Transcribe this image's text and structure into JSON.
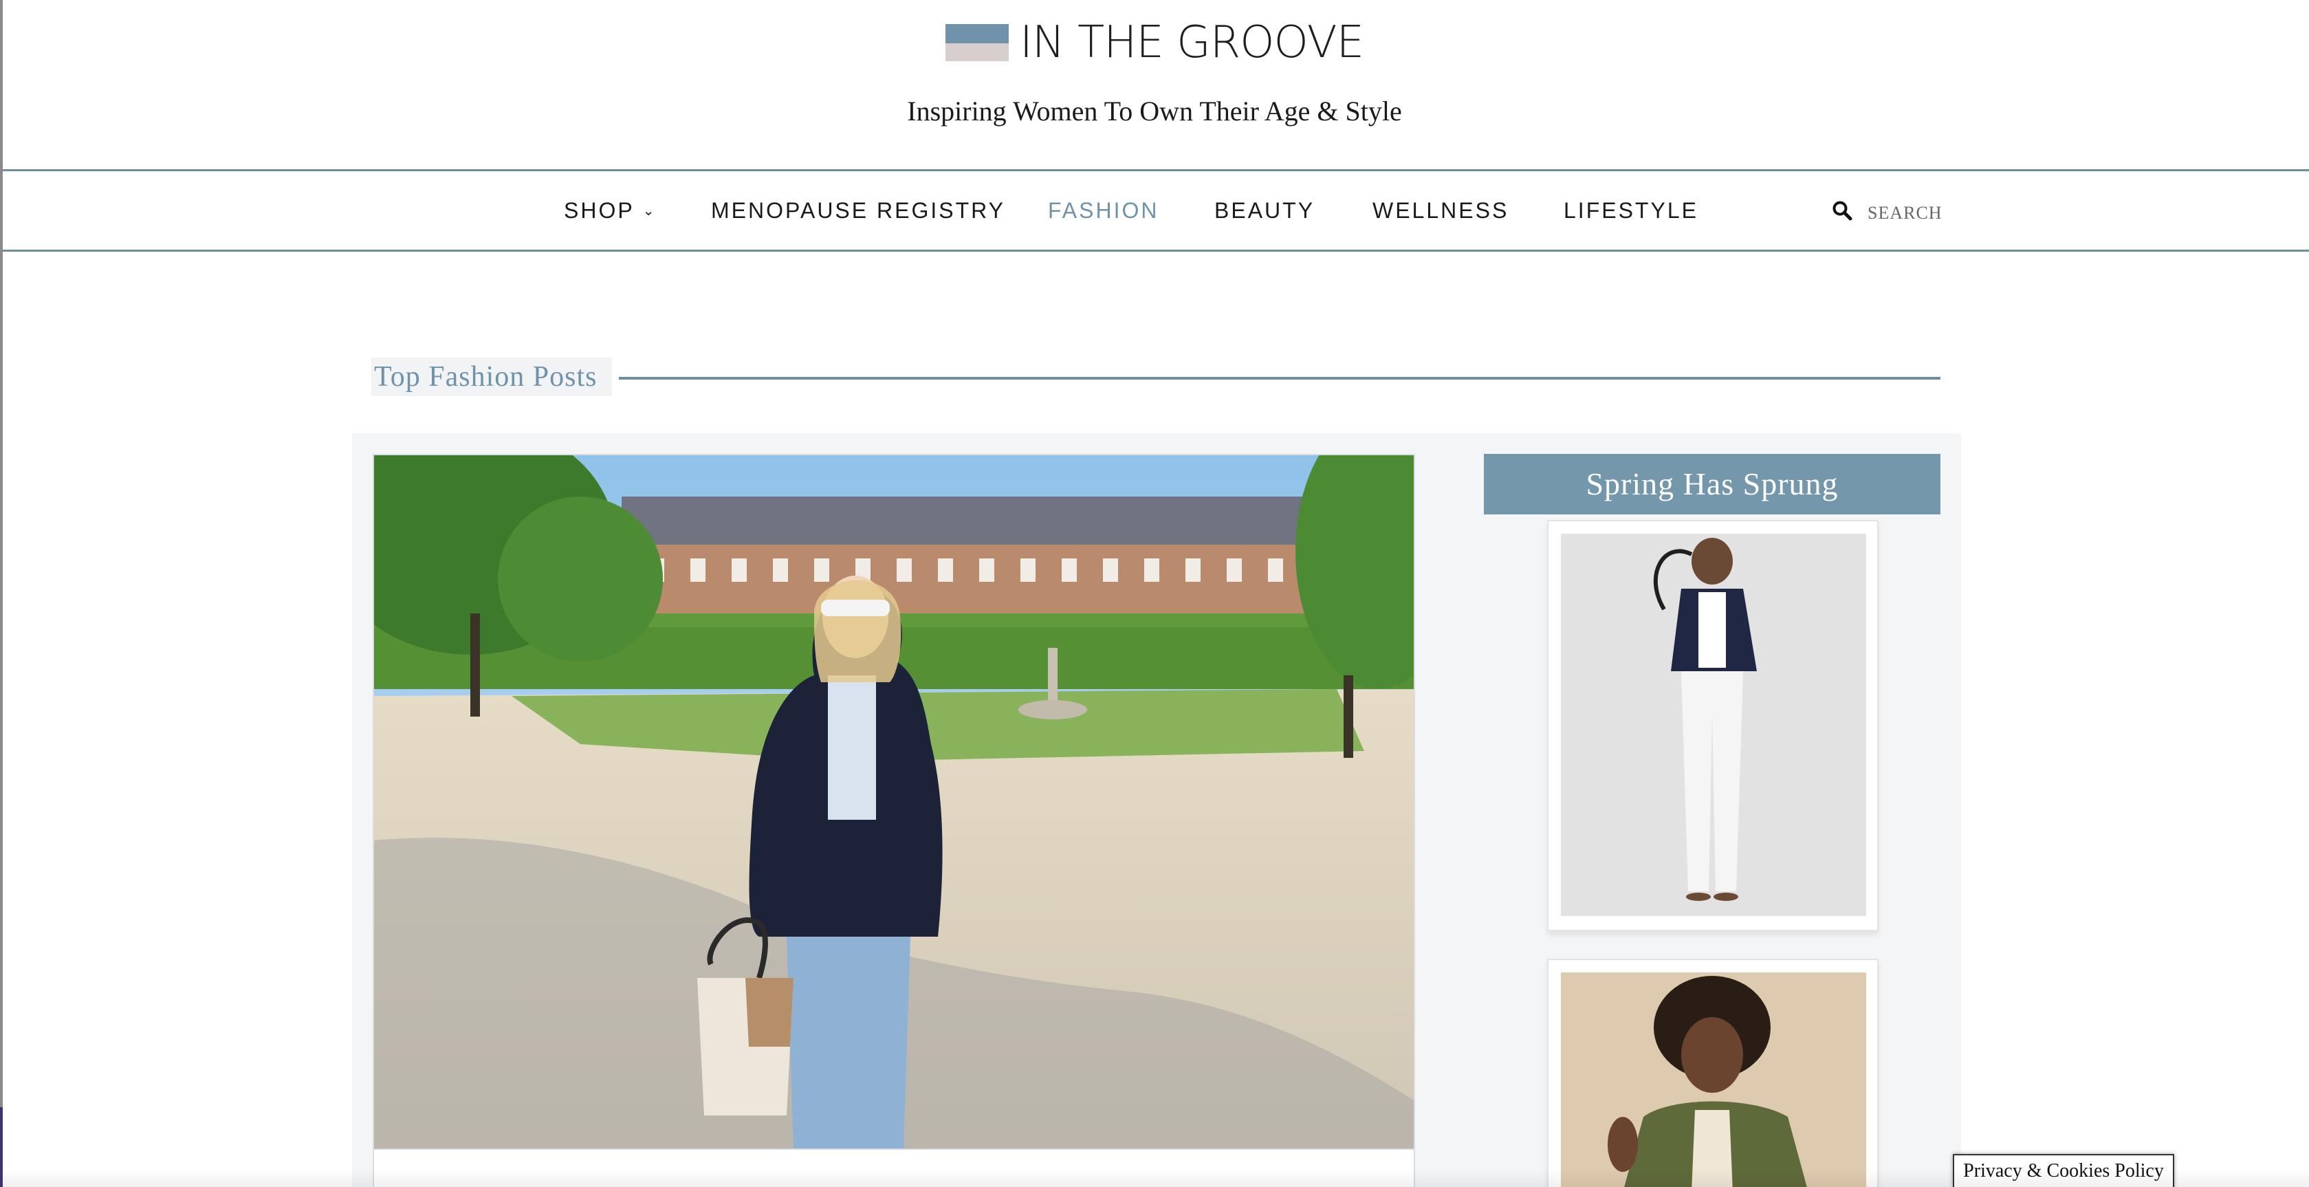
{
  "site": {
    "brand_name": "IN THE GROOVE",
    "tagline": "Inspiring Women To Own Their Age & Style",
    "brand_colors": {
      "blue": "#6e93ab",
      "pink": "#d7cfcd"
    }
  },
  "nav": {
    "items": [
      {
        "label": "SHOP",
        "has_dropdown": true,
        "icon": "chevron-down-icon"
      },
      {
        "label": "MENOPAUSE REGISTRY"
      },
      {
        "label": "FASHION",
        "active": true
      },
      {
        "label": "BEAUTY"
      },
      {
        "label": "WELLNESS"
      },
      {
        "label": "LIFESTYLE"
      }
    ],
    "search": {
      "icon": "search-icon",
      "placeholder": "SEARCH",
      "value": ""
    }
  },
  "main": {
    "section_title": "Top Fashion Posts"
  },
  "sidebar": {
    "widget_title": "Spring Has Sprung"
  },
  "footer": {
    "privacy_label": "Privacy & Cookies Policy"
  }
}
